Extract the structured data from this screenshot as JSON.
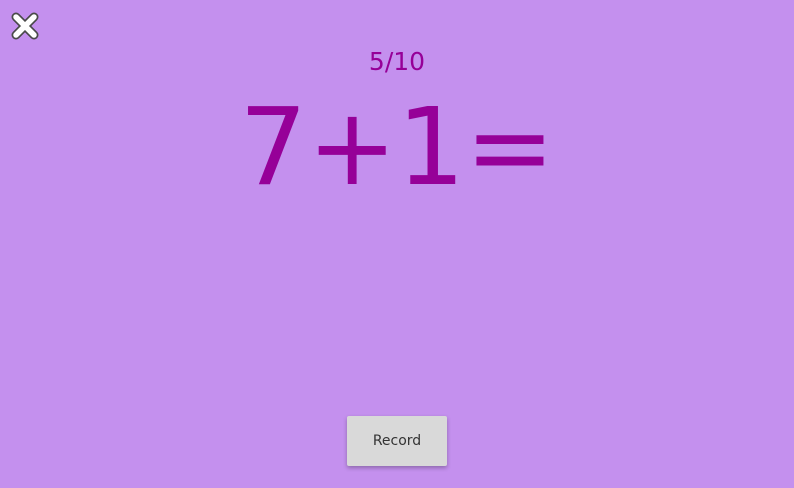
{
  "theme": {
    "background": "#c490ee",
    "accent": "#960098",
    "button_bg": "#d9d9d9"
  },
  "header": {
    "close_icon": "close-icon"
  },
  "quiz": {
    "progress": "5/10",
    "equation": "7+1="
  },
  "controls": {
    "record_label": "Record"
  }
}
